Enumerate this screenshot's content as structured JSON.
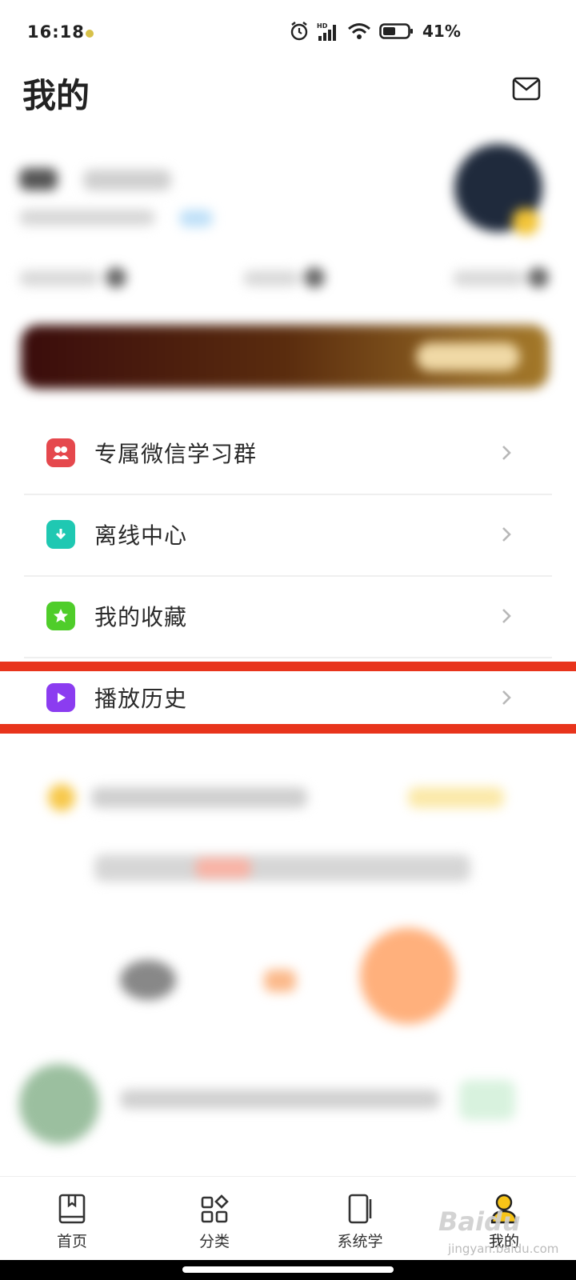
{
  "status_bar": {
    "time": "16:18",
    "battery_percent": "41%",
    "network_label": "HD"
  },
  "header": {
    "title": "我的"
  },
  "menu": {
    "items": [
      {
        "label": "专属微信学习群",
        "icon": "wechat-group-icon",
        "color": "#e5484d"
      },
      {
        "label": "离线中心",
        "icon": "download-icon",
        "color": "#1fc8b2"
      },
      {
        "label": "我的收藏",
        "icon": "star-icon",
        "color": "#4fcd2a"
      },
      {
        "label": "播放历史",
        "icon": "play-icon",
        "color": "#8b3cf0"
      }
    ]
  },
  "bottom_nav": {
    "items": [
      {
        "label": "首页",
        "icon": "book-icon"
      },
      {
        "label": "分类",
        "icon": "grid-icon"
      },
      {
        "label": "系统学",
        "icon": "notebook-icon"
      },
      {
        "label": "我的",
        "icon": "person-icon",
        "active": true
      }
    ]
  },
  "watermark": {
    "brand": "Baidu",
    "url": "jingyan.baidu.com"
  },
  "colors": {
    "highlight_red": "#e8341c",
    "active_tab_yellow": "#f7c418"
  }
}
